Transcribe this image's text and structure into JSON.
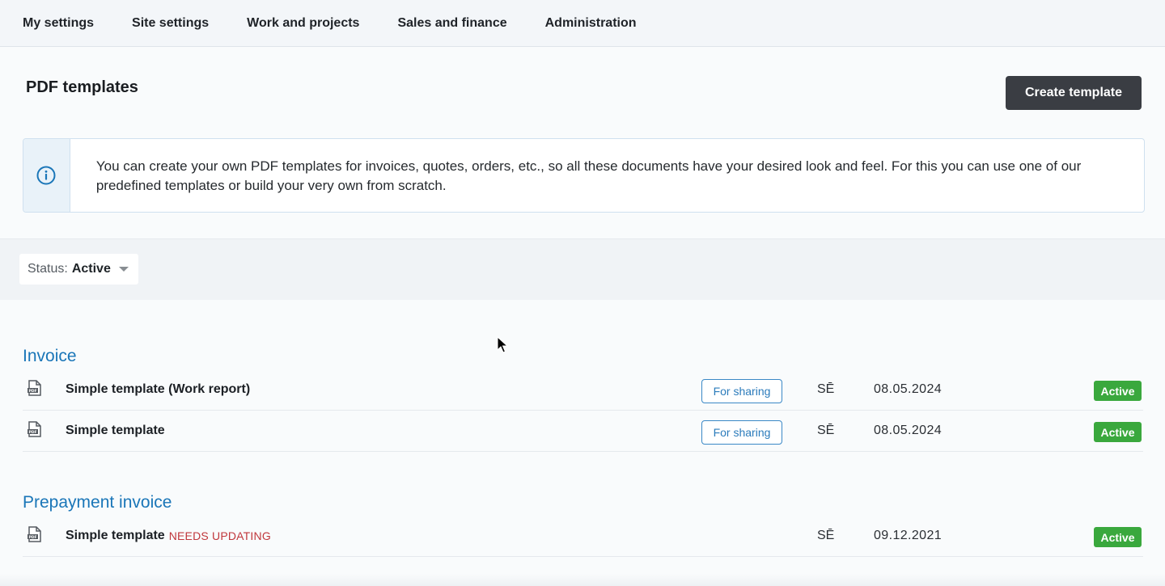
{
  "nav": {
    "items": [
      {
        "label": "My settings"
      },
      {
        "label": "Site settings"
      },
      {
        "label": "Work and projects"
      },
      {
        "label": "Sales and finance"
      },
      {
        "label": "Administration"
      }
    ]
  },
  "header": {
    "title": "PDF templates",
    "create_label": "Create template"
  },
  "info": {
    "icon": "info-circle-icon",
    "text": "You can create your own PDF templates for invoices, quotes, orders, etc., so all these documents have your desired look and feel. For this you can use one of our predefined templates or build your very own from scratch."
  },
  "filter": {
    "label": "Status:",
    "value": "Active"
  },
  "groups": [
    {
      "title": "Invoice",
      "rows": [
        {
          "name": "Simple template (Work report)",
          "share_label": "For sharing",
          "author": "SĒ",
          "date": "08.05.2024",
          "status": "Active"
        },
        {
          "name": "Simple template",
          "share_label": "For sharing",
          "author": "SĒ",
          "date": "08.05.2024",
          "status": "Active"
        }
      ]
    },
    {
      "title": "Prepayment invoice",
      "rows": [
        {
          "name": "Simple template",
          "needs": "NEEDS UPDATING",
          "author": "SĒ",
          "date": "09.12.2021",
          "status": "Active"
        }
      ]
    }
  ],
  "colors": {
    "accent_blue": "#1a76b8",
    "status_green": "#3aa83d",
    "warning_red": "#c0373c",
    "button_dark": "#3a3d43"
  }
}
